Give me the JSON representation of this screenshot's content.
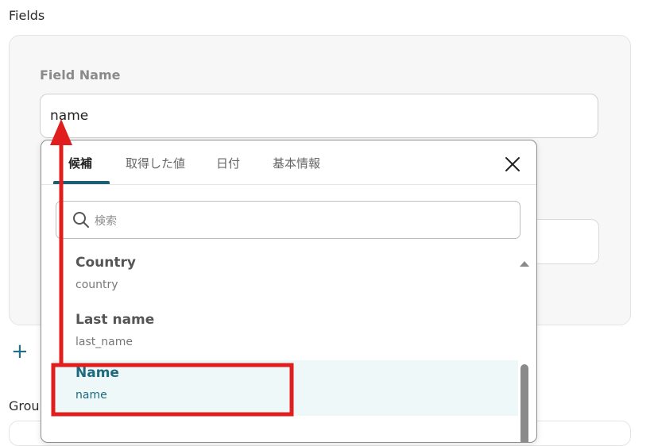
{
  "fields_section": {
    "title": "Fields"
  },
  "field": {
    "label": "Field Name",
    "value": "name"
  },
  "group_section": {
    "title": "Grou"
  },
  "picker": {
    "tabs": [
      {
        "label": "候補",
        "active": true
      },
      {
        "label": "取得した値",
        "active": false
      },
      {
        "label": "日付",
        "active": false
      },
      {
        "label": "基本情報",
        "active": false
      }
    ],
    "search": {
      "placeholder": "検索"
    },
    "items": [
      {
        "title": "Country",
        "subtitle": "country",
        "selected": false
      },
      {
        "title": "Last name",
        "subtitle": "last_name",
        "selected": false
      },
      {
        "title": "Name",
        "subtitle": "name",
        "selected": true
      }
    ]
  },
  "colors": {
    "accent": "#1b5f73",
    "annotation": "#e01e1e",
    "selected_bg": "#eff8f8"
  },
  "icons": [
    "plus-icon",
    "close-icon",
    "search-icon",
    "scroll-up-icon"
  ]
}
